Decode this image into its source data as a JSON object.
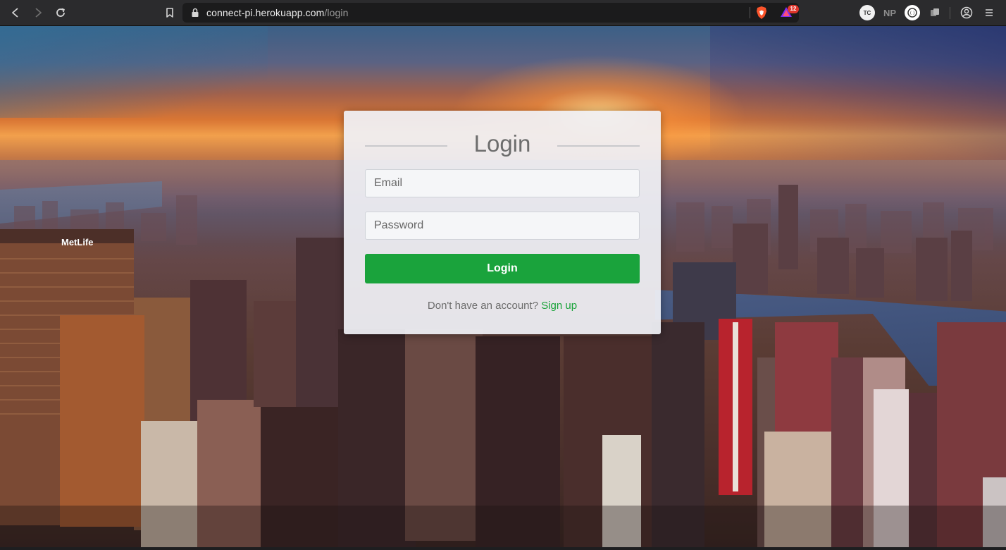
{
  "browser": {
    "url_host": "connect-pi.herokuapp.com",
    "url_path": "/login",
    "rewards_badge": "12",
    "ext_tc_label": "TC",
    "ext_np_label": "NP",
    "icons": [
      "back-icon",
      "forward-icon",
      "reload-icon",
      "bookmark-icon",
      "lock-icon",
      "brave-shields-icon",
      "brave-rewards-icon",
      "extension-tc-icon",
      "extension-np-icon",
      "extension-eye-icon",
      "extensions-puzzle-icon",
      "profile-icon",
      "menu-icon"
    ]
  },
  "login": {
    "title": "Login",
    "email_placeholder": "Email",
    "password_placeholder": "Password",
    "submit_label": "Login",
    "signup_prompt": "Don't have an account?",
    "signup_link": "Sign up",
    "accent_color": "#1aa33c"
  },
  "background": {
    "sign_text": "MetLife"
  }
}
